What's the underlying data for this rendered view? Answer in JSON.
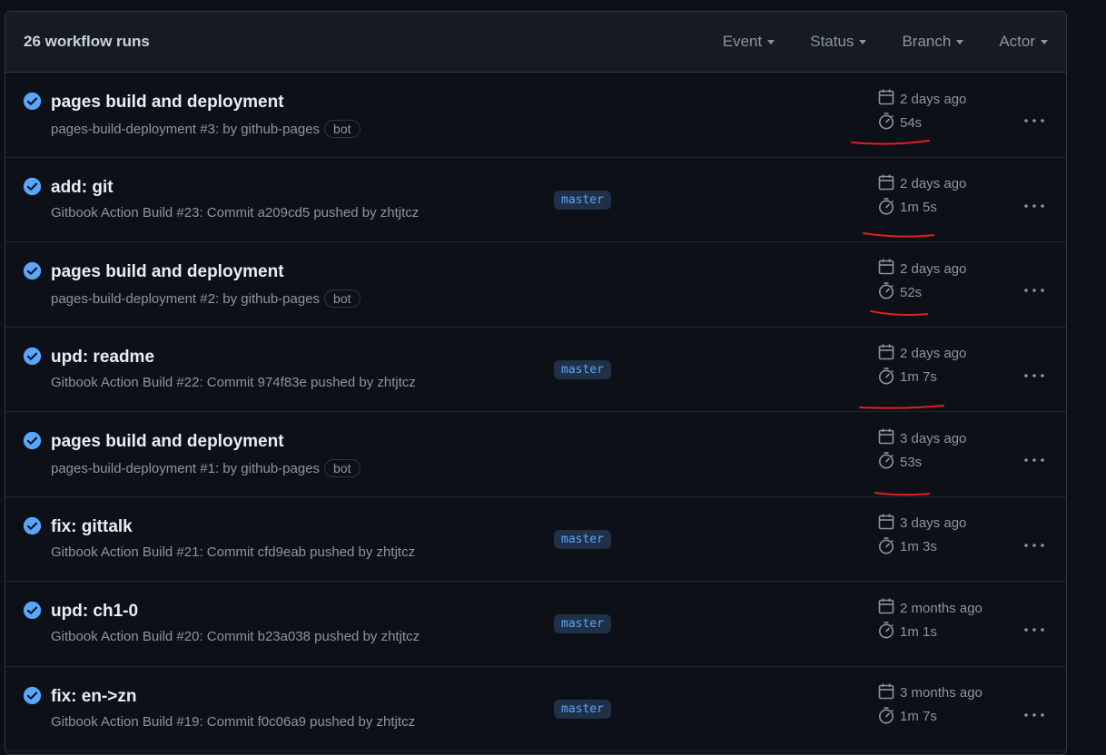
{
  "header": {
    "run_count": "26 workflow runs",
    "filters": [
      {
        "label": "Event"
      },
      {
        "label": "Status"
      },
      {
        "label": "Branch"
      },
      {
        "label": "Actor"
      }
    ]
  },
  "colors": {
    "success": "#58a6ff",
    "annotation": "#e0201c"
  },
  "runs": [
    {
      "title": "pages build and deployment",
      "workflow": "pages-build-deployment #3",
      "detail": ": by github-pages",
      "bot": "bot",
      "branch": "",
      "date": "2 days ago",
      "duration": "54s"
    },
    {
      "title": "add: git",
      "workflow": "Gitbook Action Build #23",
      "detail": ": Commit a209cd5 pushed by zhtjtcz",
      "bot": "",
      "branch": "master",
      "date": "2 days ago",
      "duration": "1m 5s"
    },
    {
      "title": "pages build and deployment",
      "workflow": "pages-build-deployment #2",
      "detail": ": by github-pages",
      "bot": "bot",
      "branch": "",
      "date": "2 days ago",
      "duration": "52s"
    },
    {
      "title": "upd: readme",
      "workflow": "Gitbook Action Build #22",
      "detail": ": Commit 974f83e pushed by zhtjtcz",
      "bot": "",
      "branch": "master",
      "date": "2 days ago",
      "duration": "1m 7s"
    },
    {
      "title": "pages build and deployment",
      "workflow": "pages-build-deployment #1",
      "detail": ": by github-pages",
      "bot": "bot",
      "branch": "",
      "date": "3 days ago",
      "duration": "53s"
    },
    {
      "title": "fix: gittalk",
      "workflow": "Gitbook Action Build #21",
      "detail": ": Commit cfd9eab pushed by zhtjtcz",
      "bot": "",
      "branch": "master",
      "date": "3 days ago",
      "duration": "1m 3s"
    },
    {
      "title": "upd: ch1-0",
      "workflow": "Gitbook Action Build #20",
      "detail": ": Commit b23a038 pushed by zhtjtcz",
      "bot": "",
      "branch": "master",
      "date": "2 months ago",
      "duration": "1m 1s"
    },
    {
      "title": "fix: en->zn",
      "workflow": "Gitbook Action Build #19",
      "detail": ": Commit f0c06a9 pushed by zhtjtcz",
      "bot": "",
      "branch": "master",
      "date": "3 months ago",
      "duration": "1m 7s"
    }
  ],
  "icons": {
    "status": "check-circle-fill-icon",
    "date": "calendar-icon",
    "duration": "stopwatch-icon",
    "menu": "kebab-horizontal-icon"
  }
}
